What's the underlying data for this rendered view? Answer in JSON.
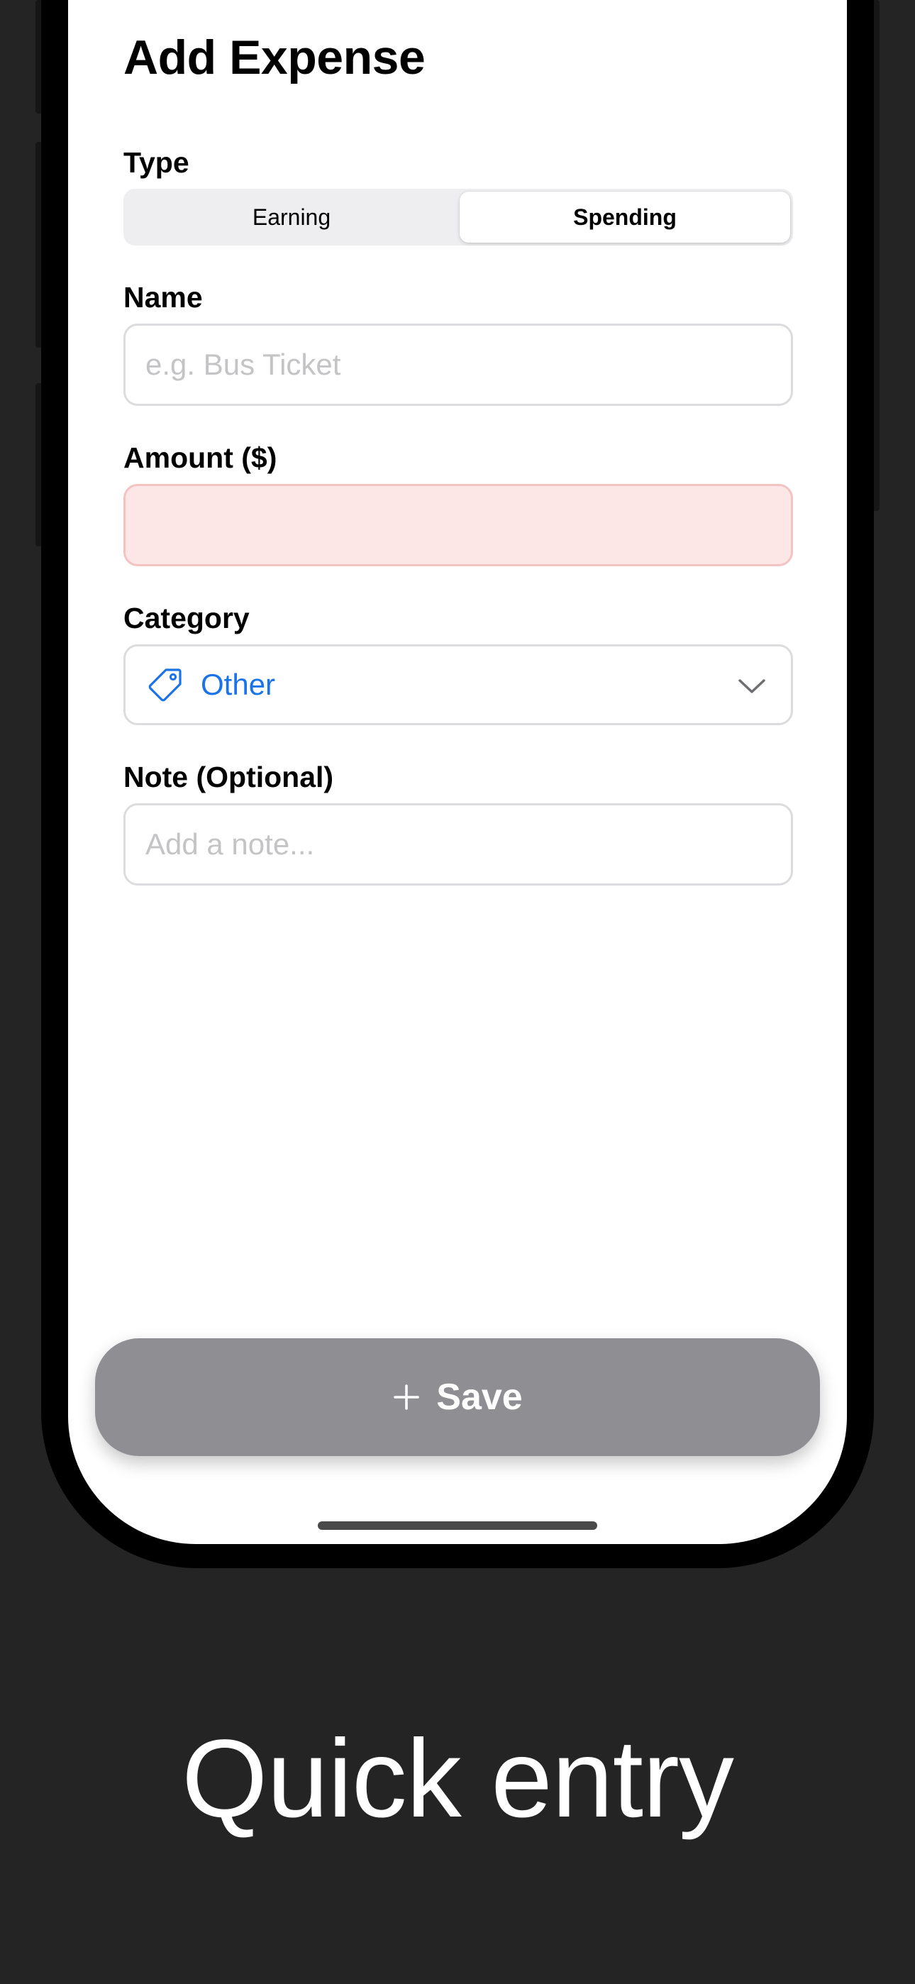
{
  "header": {
    "title": "Add Expense"
  },
  "form": {
    "type": {
      "label": "Type",
      "options": [
        "Earning",
        "Spending"
      ],
      "selected": "Spending"
    },
    "name": {
      "label": "Name",
      "value": "",
      "placeholder": "e.g. Bus Ticket"
    },
    "amount": {
      "label": "Amount ($)",
      "value": "",
      "placeholder": "",
      "state": "error"
    },
    "category": {
      "label": "Category",
      "value": "Other",
      "icon": "tag-icon",
      "dropdown_icon": "chevron-down-icon"
    },
    "note": {
      "label": "Note (Optional)",
      "value": "",
      "placeholder": "Add a note..."
    }
  },
  "actions": {
    "save_label": "Save",
    "save_icon": "plus-icon"
  },
  "caption": "Quick entry",
  "colors": {
    "background": "#242424",
    "accent": "#1a73e8",
    "error_fill": "#fde6e6",
    "save_button": "#8e8e93"
  }
}
